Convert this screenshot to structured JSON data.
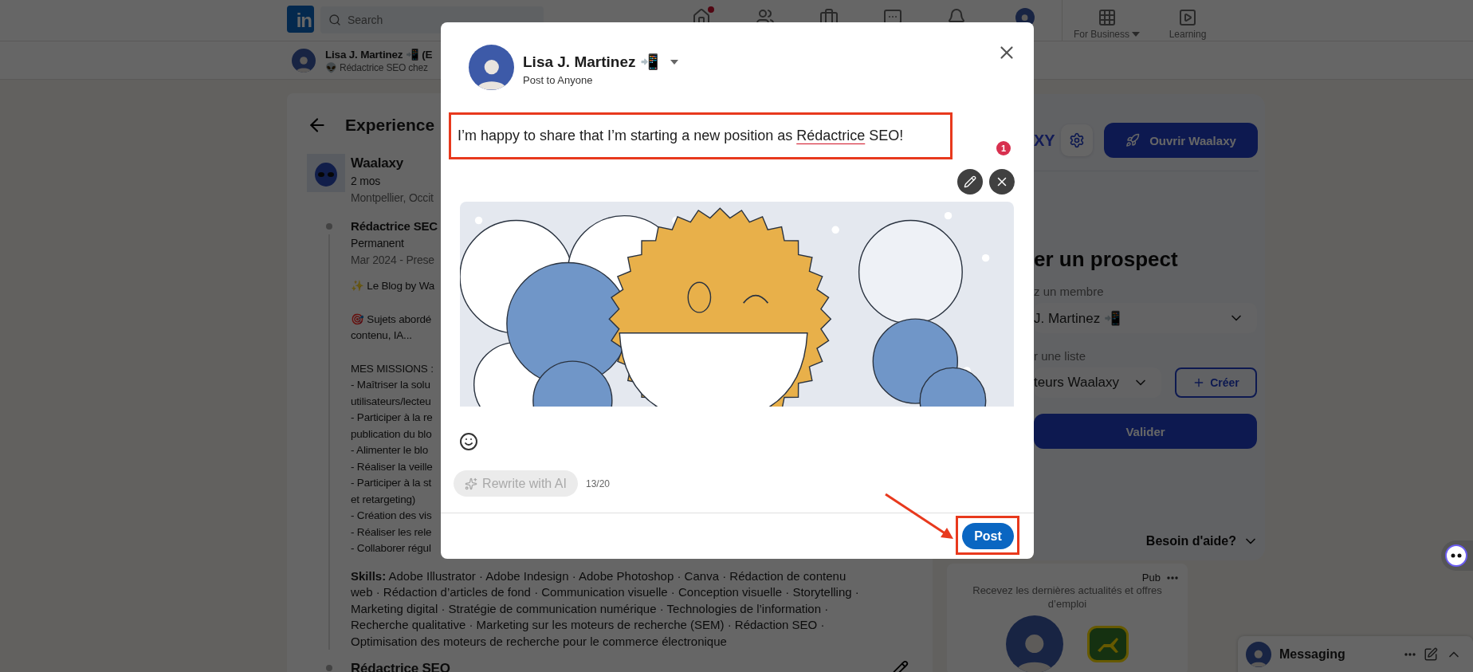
{
  "nav": {
    "logo": "in",
    "search": {
      "placeholder": "Search"
    },
    "business": {
      "label": "For Business"
    },
    "learning": {
      "label": "Learning"
    }
  },
  "profile_strip": {
    "name": "Lisa J. Martinez 📲 (E",
    "headline": "👽 Rédactrice SEO chez"
  },
  "experience": {
    "title": "Experience",
    "company": {
      "name": "Waalaxy",
      "duration": "2 mos",
      "location": "Montpellier, Occit"
    },
    "positions": [
      {
        "title": "Rédactrice SEC",
        "type": "Permanent",
        "dates": "Mar 2024 - Prese",
        "description": [
          [
            "✨ Le Blog by Wa"
          ],
          [
            "🎯 Sujets abordé",
            "contenu, IA..."
          ],
          [
            "MES MISSIONS :",
            "- Maîtriser la solu",
            "utilisateurs/lecteu",
            "- Participer à la re",
            "publication du blo",
            "- Alimenter le blo",
            "- Réaliser la veille",
            "- Participer à la st",
            "et retargeting)",
            "- Création des vis",
            "- Réaliser les rele",
            "- Collaborer régul"
          ]
        ],
        "skills": "**Skills:** Adobe Illustrator · Adobe Indesign · Adobe Photoshop · Canva · Rédaction de contenu web · Rédaction d’articles de fond · Communication visuelle · Conception visuelle · Storytelling · Marketing digital · Stratégie de communication numérique · Technologies de l’information · Recherche qualitative · Marketing sur les moteurs de recherche (SEM) · Rédaction SEO · Optimisation des moteurs de recherche pour le commerce électronique"
      },
      {
        "title": "Rédactrice SEO"
      }
    ]
  },
  "waalaxy": {
    "brand": "XY",
    "open_button": "Ouvrir Waalaxy",
    "heading": "er un prospect",
    "member_label": "z un membre",
    "member_value": "J. Martinez 📲",
    "list_label": "r une liste",
    "list_value": "teurs Waalaxy",
    "create_button": "Créer",
    "submit_button": "Valider",
    "help": "Besoin d'aide?"
  },
  "ad": {
    "label": "Pub",
    "text": "Recevez les dernières actualités et offres d’emploi"
  },
  "messaging": {
    "label": "Messaging"
  },
  "modal": {
    "author": "Lisa J. Martinez 📲",
    "audience": "Post to Anyone",
    "text_parts": [
      {
        "text": "I’m happy to share that I’m starting a new position as ",
        "flagged": false
      },
      {
        "text": "Rédactrice",
        "flagged": true
      },
      {
        "text": " SEO!",
        "flagged": false
      }
    ],
    "badge": "1",
    "rewrite_button": {
      "label": "Rewrite with AI",
      "disabled": true
    },
    "char_count": "13/20",
    "post_button": "Post"
  }
}
